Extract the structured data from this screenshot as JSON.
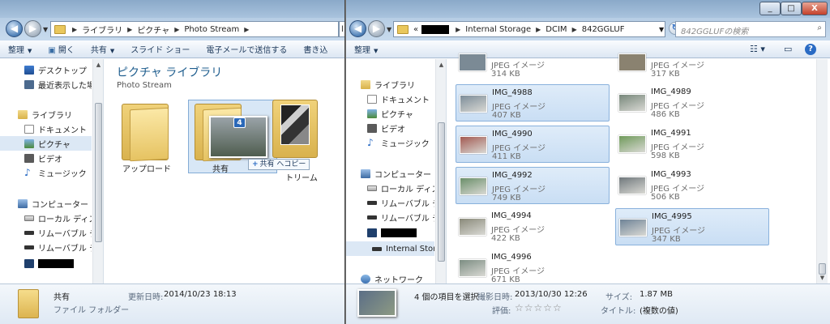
{
  "left_window": {
    "address": {
      "crumbs": [
        "ライブラリ",
        "ピクチャ",
        "Photo Stream"
      ],
      "overflow_glyph": "l"
    },
    "toolbar": [
      "整理",
      "開く",
      "共有",
      "スライド ショー",
      "電子メールで送信する",
      "書き込"
    ],
    "toolbar_dropdowns": [
      true,
      false,
      true,
      false,
      false,
      false
    ],
    "nav": {
      "favorites": [
        "デスクトップ",
        "最近表示した場所"
      ],
      "libraries_header": "ライブラリ",
      "libraries": [
        "ドキュメント",
        "ピクチャ",
        "ビデオ",
        "ミュージック"
      ],
      "computer_header": "コンピューター",
      "computer": [
        "ローカル ディス",
        "リムーバブル デ",
        "リムーバブル デ"
      ]
    },
    "library_title": "ピクチャ ライブラリ",
    "library_subtitle": "Photo Stream",
    "folders": [
      {
        "label": "アップロード"
      },
      {
        "label": "共有",
        "selected": true
      },
      {
        "label": "ス\nトリーム"
      }
    ],
    "drag": {
      "count": "4",
      "tip_plus": "+",
      "tip_text": "共有 へコピー"
    },
    "details": {
      "name": "共有",
      "type": "ファイル フォルダー",
      "modified_label": "更新日時:",
      "modified_value": "2014/10/23 18:13"
    }
  },
  "right_window": {
    "window_controls": [
      "_",
      "□",
      "X"
    ],
    "address": {
      "prefix": "«",
      "crumbs": [
        "Internal Storage",
        "DCIM",
        "842GGLUF"
      ]
    },
    "search_placeholder": "842GGLUFの検索",
    "toolbar": [
      "整理"
    ],
    "nav": {
      "libraries_header": "ライブラリ",
      "libraries": [
        "ドキュメント",
        "ピクチャ",
        "ビデオ",
        "ミュージック"
      ],
      "computer_header": "コンピューター",
      "computer": [
        "ローカル ディス",
        "リムーバブル デ",
        "リムーバブル デ"
      ],
      "internal_storage": "Internal Stora",
      "network": "ネットワーク"
    },
    "partial_files": [
      {
        "type": "JPEG イメージ",
        "size": "314 KB"
      },
      {
        "type": "JPEG イメージ",
        "size": "317 KB"
      }
    ],
    "files": [
      {
        "name": "IMG_4988",
        "type": "JPEG イメージ",
        "size": "407 KB",
        "selected": true,
        "thumb": "#7d8d99"
      },
      {
        "name": "IMG_4989",
        "type": "JPEG イメージ",
        "size": "486 KB",
        "selected": false,
        "thumb": "#77877a"
      },
      {
        "name": "IMG_4990",
        "type": "JPEG イメージ",
        "size": "411 KB",
        "selected": true,
        "thumb": "#a35a52"
      },
      {
        "name": "IMG_4991",
        "type": "JPEG イメージ",
        "size": "598 KB",
        "selected": false,
        "thumb": "#6f9a5a"
      },
      {
        "name": "IMG_4992",
        "type": "JPEG イメージ",
        "size": "749 KB",
        "selected": true,
        "thumb": "#6b8f6a"
      },
      {
        "name": "IMG_4993",
        "type": "JPEG イメージ",
        "size": "506 KB",
        "selected": false,
        "thumb": "#70787c"
      },
      {
        "name": "IMG_4994",
        "type": "JPEG イメージ",
        "size": "422 KB",
        "selected": false,
        "thumb": "#8a8a7a"
      },
      {
        "name": "IMG_4995",
        "type": "JPEG イメージ",
        "size": "347 KB",
        "selected": true,
        "thumb": "#6e8397"
      },
      {
        "name": "IMG_4996",
        "type": "JPEG イメージ",
        "size": "671 KB",
        "selected": false,
        "thumb": "#7c8d82"
      }
    ],
    "details": {
      "selection": "4 個の項目を選択",
      "taken_label": "撮影日時:",
      "taken_value": "2013/10/30 12:26",
      "rating_label": "評価:",
      "rating_stars": "☆☆☆☆☆",
      "size_label": "サイズ:",
      "size_value": "1.87 MB",
      "title_label": "タイトル:",
      "title_value": "(複数の値)"
    }
  }
}
